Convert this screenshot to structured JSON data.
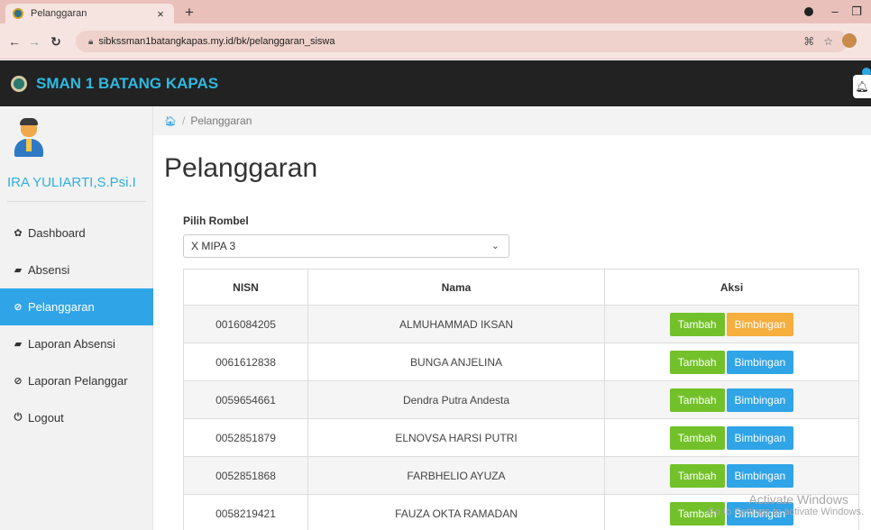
{
  "browser": {
    "tab_title": "Pelanggaran",
    "tab_close": "×",
    "new_tab": "+",
    "url": "sibkssman1batangkapas.my.id/bk/pelanggaran_siswa"
  },
  "app": {
    "brand": "SMAN 1 BATANG KAPAS"
  },
  "sidebar": {
    "user_name": "IRA YULIARTI,S.Psi.I",
    "items": [
      {
        "label": "Dashboard",
        "icon": "dashboard-icon",
        "glyph": "✿",
        "active": false
      },
      {
        "label": "Absensi",
        "icon": "book-icon",
        "glyph": "▰",
        "active": false
      },
      {
        "label": "Pelanggaran",
        "icon": "ban-icon",
        "glyph": "⊘",
        "active": true
      },
      {
        "label": "Laporan Absensi",
        "icon": "book-icon",
        "glyph": "▰",
        "active": false
      },
      {
        "label": "Laporan Pelanggar",
        "icon": "ban-icon",
        "glyph": "⊘",
        "active": false
      },
      {
        "label": "Logout",
        "icon": "power-icon",
        "glyph": "⏻",
        "active": false
      }
    ]
  },
  "breadcrumb": {
    "current": "Pelanggaran"
  },
  "page": {
    "title": "Pelanggaran",
    "filter_label": "Pilih Rombel",
    "selected_rombel": "X MIPA 3"
  },
  "table": {
    "headers": [
      "NISN",
      "Nama",
      "Aksi"
    ],
    "add_label": "Tambah",
    "guide_label": "Bimbingan",
    "rows": [
      {
        "nisn": "0016084205",
        "nama": "ALMUHAMMAD IKSAN",
        "guide_color": "#f6ae3d"
      },
      {
        "nisn": "0061612838",
        "nama": "BUNGA ANJELINA",
        "guide_color": "#2fa4e7"
      },
      {
        "nisn": "0059654661",
        "nama": "Dendra Putra Andesta",
        "guide_color": "#2fa4e7"
      },
      {
        "nisn": "0052851879",
        "nama": "ELNOVSA HARSI PUTRI",
        "guide_color": "#2fa4e7"
      },
      {
        "nisn": "0052851868",
        "nama": "FARBHELIO AYUZA",
        "guide_color": "#2fa4e7"
      },
      {
        "nisn": "0058219421",
        "nama": "FAUZA OKTA RAMADAN",
        "guide_color": "#2fa4e7"
      }
    ]
  },
  "watermark": {
    "line1": "Activate Windows",
    "line2": "Go to Settings to activate Windows."
  },
  "colors": {
    "accent": "#2fa4e7",
    "header_bg": "#222222",
    "brand": "#2fb9e0",
    "add_button": "#73c12a"
  }
}
